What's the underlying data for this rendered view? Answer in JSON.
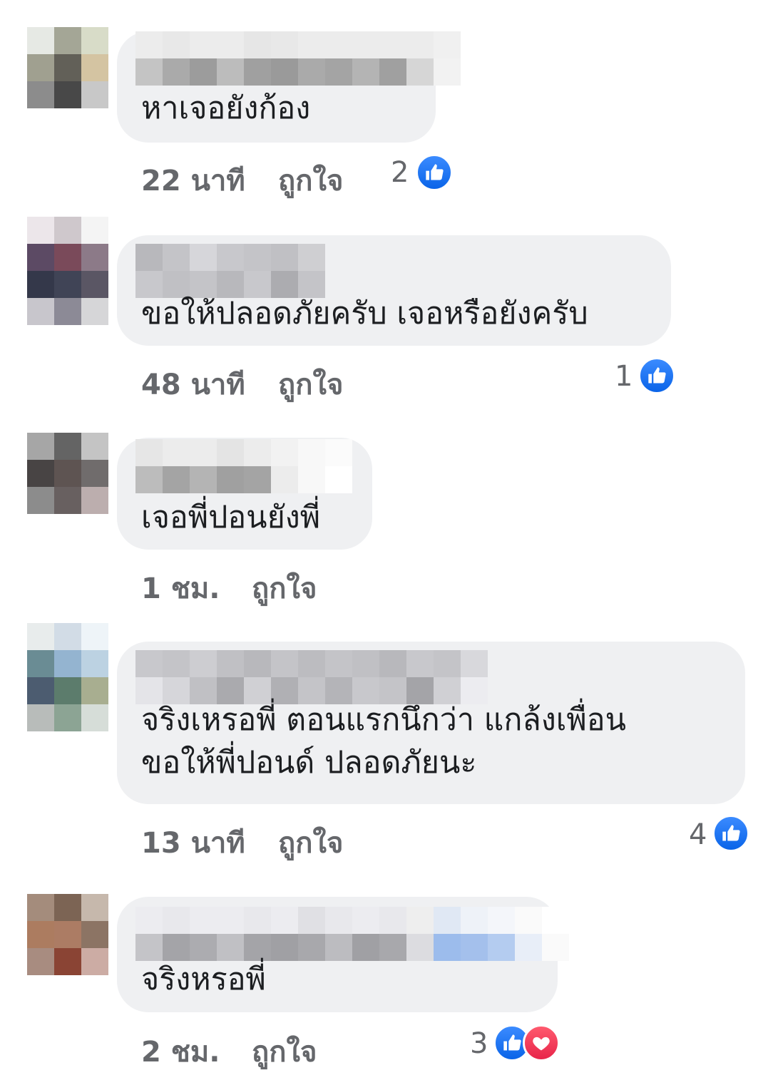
{
  "comments": [
    {
      "text": "หาเจอยังก้อง",
      "time": "22 นาที",
      "like_label": "ถูกใจ",
      "reaction_count": "2",
      "reactions": [
        "like-icon"
      ],
      "avatar_colors": [
        "#e6e9e4",
        "#a4a696",
        "#d8dcc8",
        "#a0a090",
        "#626058",
        "#d4c4a2",
        "#8c8c8c",
        "#484848",
        "#c8c8c8"
      ],
      "name_colors": [
        [
          "#ececec",
          "#e8e8e8",
          "#ececec",
          "#ececec",
          "#e6e6e6",
          "#e8e8e8",
          "#ececec",
          "#ececec",
          "#ececec",
          "#ececec",
          "#ececec",
          "#f0f0f0"
        ],
        [
          "#c4c4c4",
          "#aaaaaa",
          "#9c9c9c",
          "#bcbcbc",
          "#a0a0a0",
          "#9a9a9a",
          "#aaaaaa",
          "#a4a4a4",
          "#b4b4b4",
          "#a0a0a0",
          "#d6d6d6",
          "#f2f2f2"
        ]
      ]
    },
    {
      "text": "ขอให้ปลอดภัยครับ เจอหรือยังครับ",
      "time": "48 นาที",
      "like_label": "ถูกใจ",
      "reaction_count": "1",
      "reactions": [
        "like-icon"
      ],
      "avatar_colors": [
        "#ece6ea",
        "#cfc8cc",
        "#f4f4f4",
        "#5c4a64",
        "#7a4a5a",
        "#8c7a88",
        "#34384a",
        "#404456",
        "#5a5664",
        "#c8c6cc",
        "#8c8a96",
        "#d6d6d8"
      ],
      "name_colors": [
        [
          "#b8b8bc",
          "#c4c4c8",
          "#d6d6da",
          "#c8c8cc",
          "#c4c4c8",
          "#c0c0c4",
          "#cfcfd2"
        ],
        [
          "#c8c8cc",
          "#c0c0c4",
          "#c4c4c8",
          "#b8b8bc",
          "#c8c8cc",
          "#acacb0",
          "#c4c4c8"
        ]
      ]
    },
    {
      "text": "เจอพี่ปอนยังพี่",
      "time": "1 ชม.",
      "like_label": "ถูกใจ",
      "reaction_count": "",
      "reactions": [],
      "avatar_colors": [
        "#a6a6a6",
        "#646464",
        "#c4c4c4",
        "#484444",
        "#5e5452",
        "#706c6c",
        "#8c8c8c",
        "#686060",
        "#bcaeae"
      ],
      "name_colors": [
        [
          "#e6e6e6",
          "#ececec",
          "#ececec",
          "#e4e4e4",
          "#ececec",
          "#f2f2f2",
          "#f8f8f8",
          "#fbfbfb"
        ],
        [
          "#bcbcbc",
          "#a4a4a4",
          "#b4b4b4",
          "#a0a0a0",
          "#a4a4a4",
          "#ececec",
          "#f8f8f8",
          "#ffffff"
        ]
      ]
    },
    {
      "text": "จริงเหรอพี่ ตอนแรกนึกว่า แกล้งเพื่อน\nขอให้พี่ปอนด์ ปลอดภัยนะ",
      "time": "13 นาที",
      "like_label": "ถูกใจ",
      "reaction_count": "4",
      "reactions": [
        "like-icon"
      ],
      "avatar_colors": [
        "#e8ecec",
        "#d2dce6",
        "#eef4f8",
        "#6a8c94",
        "#94b4d0",
        "#bcd2e2",
        "#4c5c70",
        "#5c7c6c",
        "#a8ae90",
        "#b8bcba",
        "#8ca494",
        "#d6ddd8"
      ],
      "name_colors": [
        [
          "#c8c8cc",
          "#c4c4c8",
          "#cdcdd1",
          "#c0c0c4",
          "#b8b8bc",
          "#c4c4c8",
          "#bcbcc0",
          "#c4c4c8",
          "#c0c0c4",
          "#b8b8bc",
          "#c8c8cc",
          "#c4c4c8",
          "#d8d8dc"
        ],
        [
          "#e4e4e8",
          "#d6d6da",
          "#c0c0c4",
          "#aaaaae",
          "#d0d0d4",
          "#b0b0b4",
          "#c4c4c8",
          "#b4b4b8",
          "#c8c8cc",
          "#c4c4c8",
          "#a4a4a8",
          "#d0d0d4",
          "#ececf0"
        ]
      ]
    },
    {
      "text": "จริงหรอพี่",
      "time": "2 ชม.",
      "like_label": "ถูกใจ",
      "reaction_count": "3",
      "reactions": [
        "like-icon",
        "heart-icon"
      ],
      "avatar_colors": [
        "#a48c7c",
        "#7c6454",
        "#c6b8ac",
        "#ac7c60",
        "#ac7c64",
        "#8c7464",
        "#a88c80",
        "#8a4434",
        "#ccaca4"
      ],
      "name_colors": [
        [
          "#ececf0",
          "#e8e8ec",
          "#ececf0",
          "#ececf0",
          "#e8e8ec",
          "#ececf0",
          "#e0e0e4",
          "#e8e8ec",
          "#ececf0",
          "#e8e8ec",
          "#eeeeee",
          "#e0e8f4",
          "#eef2f8",
          "#f4f6fa",
          "#fafafa",
          "#ffffff"
        ],
        [
          "#c4c4c8",
          "#a4a4a8",
          "#acacb0",
          "#c0c0c4",
          "#a4a4a8",
          "#a0a0a4",
          "#a8a8ac",
          "#bcbcc0",
          "#a0a0a4",
          "#a8a8ac",
          "#dcdce0",
          "#9cbcec",
          "#a4c0ec",
          "#b4ccf0",
          "#e8eef8",
          "#fafafa"
        ]
      ]
    }
  ]
}
